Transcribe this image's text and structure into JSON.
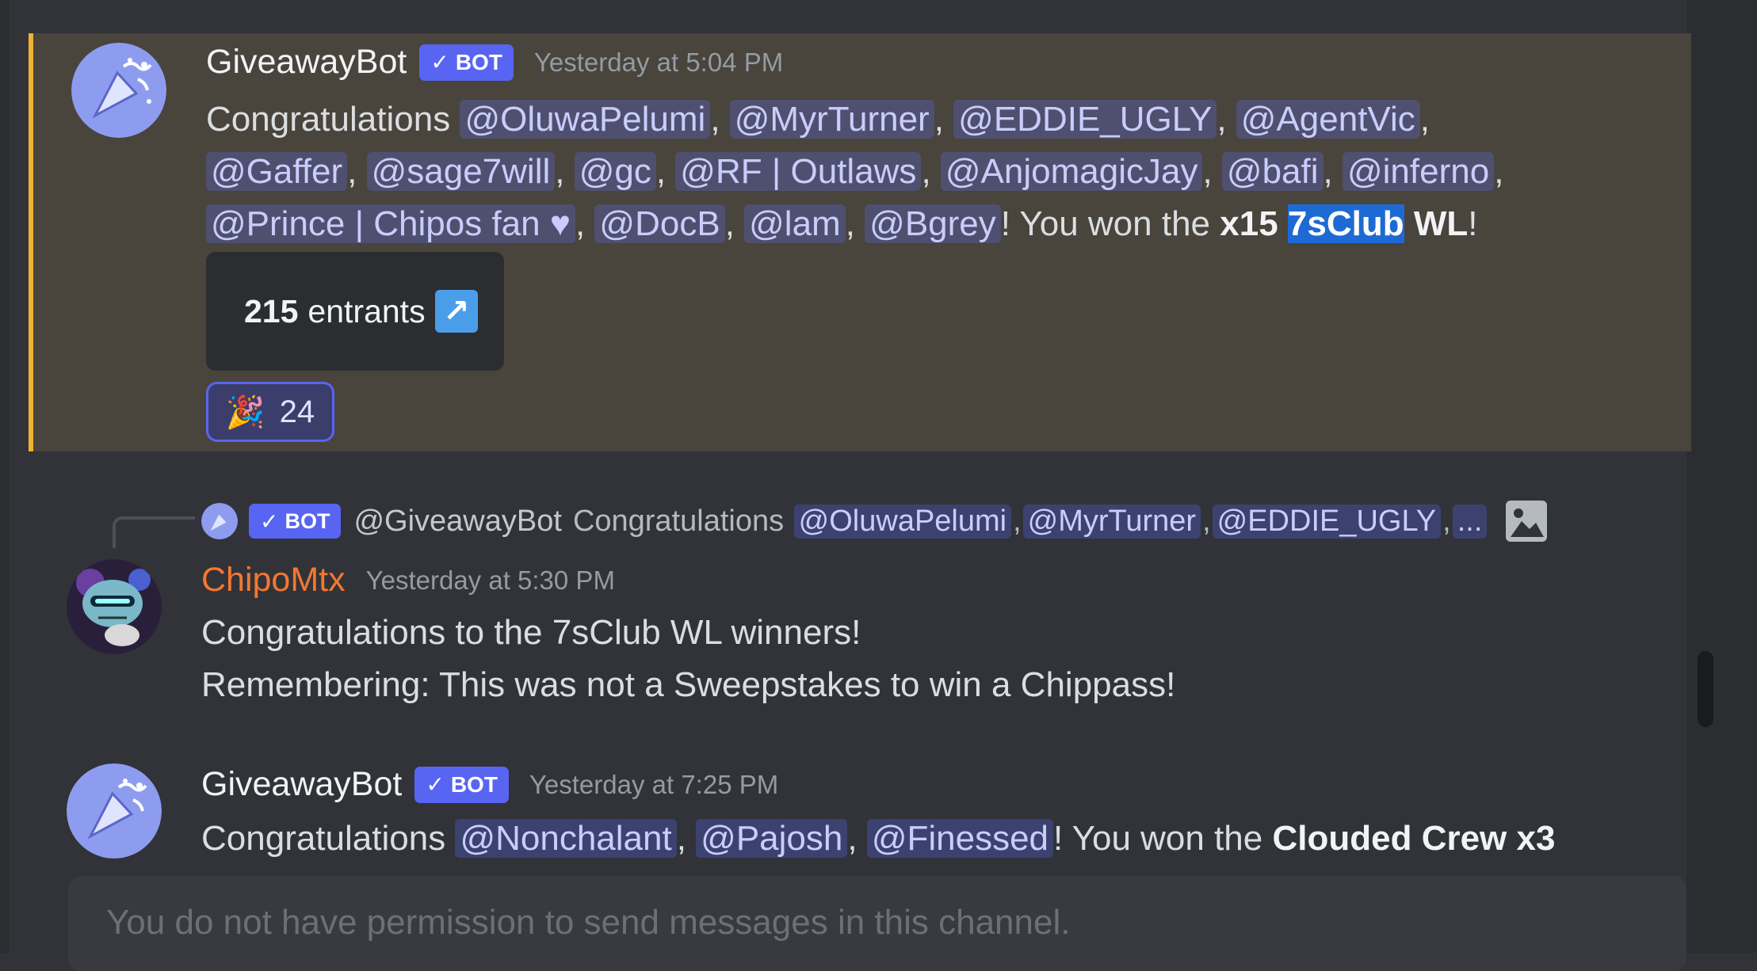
{
  "messages": [
    {
      "author": "GiveawayBot",
      "bot_label": "BOT",
      "timestamp": "Yesterday at 5:04 PM",
      "greeting": "Congratulations",
      "mentions_line1": [
        "@OluwaPelumi",
        "@MyrTurner",
        "@EDDIE_UGLY",
        "@AgentVic"
      ],
      "mentions_line2": [
        "@Gaffer",
        "@sage7will",
        "@gc",
        "@RF | Outlaws",
        "@AnjomagicJay",
        "@bafi",
        "@inferno"
      ],
      "mentions_line3": [
        "@Prince | Chipos fan ♥",
        "@DocB",
        "@lam",
        "@Bgrey"
      ],
      "won_text": "! You won the ",
      "prize_prefix": "x15",
      "prize_selected": "7sClub",
      "prize_suffix": "WL",
      "end_punct": "!",
      "entrants_count": "215",
      "entrants_label": "entrants",
      "reaction_emoji": "🎉",
      "reaction_count": "24"
    },
    {
      "reply_author": "@GiveawayBot",
      "reply_bot_label": "BOT",
      "reply_text": "Congratulations",
      "reply_mentions": [
        "@OluwaPelumi",
        "@MyrTurner",
        "@EDDIE_UGLY"
      ],
      "reply_more": "...",
      "author": "ChipoMtx",
      "timestamp": "Yesterday at 5:30 PM",
      "line1": "Congratulations to the 7sClub WL winners!",
      "line2": "Remembering: This was not a Sweepstakes to win a Chippass!"
    },
    {
      "author": "GiveawayBot",
      "bot_label": "BOT",
      "timestamp": "Yesterday at 7:25 PM",
      "greeting": "Congratulations",
      "mentions": [
        "@Nonchalant",
        "@Pajosh",
        "@Finessed"
      ],
      "won_text": "! You won the ",
      "prize": "Clouded Crew x3"
    }
  ],
  "composer": {
    "placeholder": "You do not have permission to send messages in this channel."
  },
  "colors": {
    "background": "#313338",
    "highlight": "#49443c",
    "highlight_border": "#f0b232",
    "mention_bg": "#3c4270",
    "blurple": "#5865f2",
    "orange_name": "#f57731"
  }
}
